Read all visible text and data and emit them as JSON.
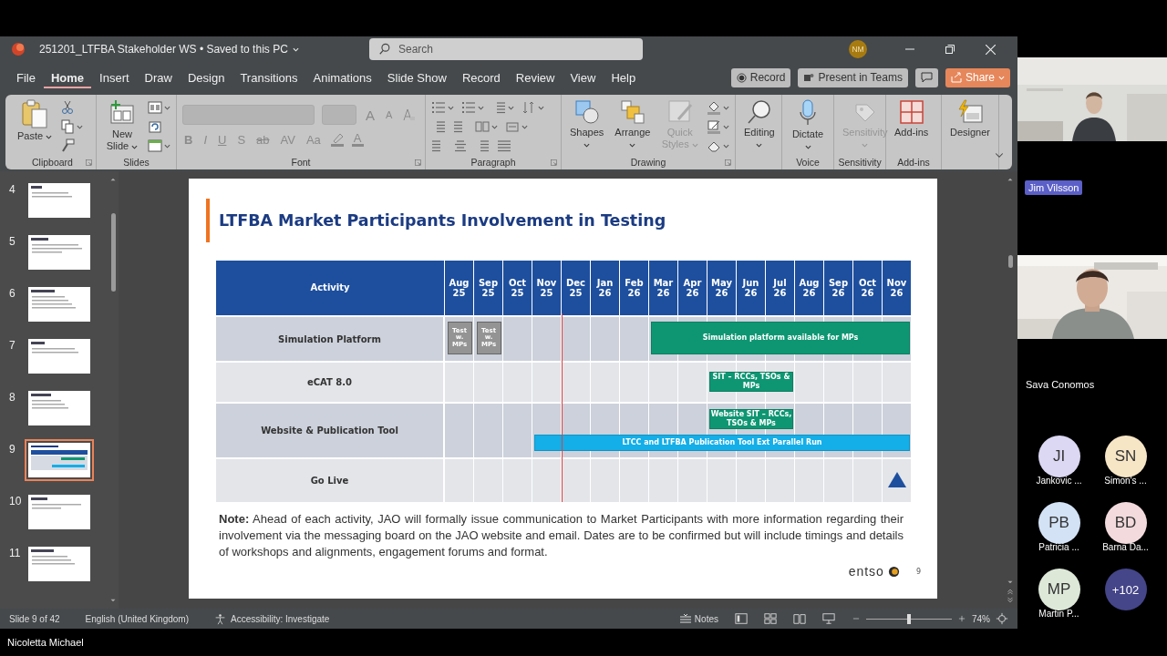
{
  "title_bar": {
    "title": "251201_LTFBA Stakeholder WS • Saved to this PC",
    "search_placeholder": "Search",
    "user_initials": "NM"
  },
  "tabs": [
    {
      "label": "File",
      "selected": false
    },
    {
      "label": "Home",
      "selected": true
    },
    {
      "label": "Insert",
      "selected": false
    },
    {
      "label": "Draw",
      "selected": false
    },
    {
      "label": "Design",
      "selected": false
    },
    {
      "label": "Transitions",
      "selected": false
    },
    {
      "label": "Animations",
      "selected": false
    },
    {
      "label": "Slide Show",
      "selected": false
    },
    {
      "label": "Record",
      "selected": false
    },
    {
      "label": "Review",
      "selected": false
    },
    {
      "label": "View",
      "selected": false
    },
    {
      "label": "Help",
      "selected": false
    }
  ],
  "actions": [
    {
      "kind": "record",
      "label": "Record"
    },
    {
      "kind": "teams",
      "label": "Present in Teams"
    },
    {
      "kind": "comments"
    },
    {
      "kind": "share",
      "label": "Share"
    }
  ],
  "ribbon": [
    {
      "kind": "clipboard",
      "label": "Clipboard",
      "buttons": [
        {
          "kind": "paste",
          "label": "Paste",
          "disabled": false,
          "has_menu": true
        }
      ]
    },
    {
      "kind": "slides",
      "label": "Slides",
      "buttons": [
        {
          "kind": "new-slide",
          "label": "New Slide",
          "disabled": false,
          "has_menu": true
        }
      ]
    },
    {
      "kind": "font",
      "label": "Font",
      "disabled": true,
      "grow": [
        "A",
        "A"
      ],
      "format": [
        "B",
        "I",
        "U",
        "S",
        "ab",
        "AV",
        "Aa"
      ],
      "color_tool": "A"
    },
    {
      "kind": "paragraph",
      "label": "Paragraph"
    },
    {
      "kind": "drawing",
      "label": "Drawing",
      "buttons": [
        {
          "kind": "shapes",
          "label": "Shapes",
          "disabled": false,
          "has_menu": true
        },
        {
          "kind": "arrange",
          "label": "Arrange",
          "disabled": false,
          "has_menu": true
        },
        {
          "kind": "quick-styles",
          "label": "Quick Styles",
          "disabled": true,
          "has_menu": true
        }
      ]
    },
    {
      "kind": "editing",
      "buttons": [
        {
          "kind": "editing",
          "label": "Editing",
          "disabled": false,
          "has_menu": true
        }
      ]
    },
    {
      "kind": "voice",
      "label": "Voice",
      "buttons": [
        {
          "kind": "dictate",
          "label": "Dictate",
          "disabled": false,
          "has_menu": true
        }
      ]
    },
    {
      "kind": "sensitivity",
      "label": "Sensitivity",
      "buttons": [
        {
          "kind": "sensitivity",
          "label": "Sensitivity",
          "disabled": true,
          "has_menu": true
        }
      ]
    },
    {
      "kind": "addins",
      "label": "Add-ins",
      "buttons": [
        {
          "kind": "addins",
          "label": "Add-ins",
          "disabled": false,
          "has_menu": false
        }
      ]
    },
    {
      "kind": "designer",
      "buttons": [
        {
          "kind": "designer",
          "label": "Designer",
          "disabled": false,
          "has_menu": false
        }
      ]
    }
  ],
  "thumbnails": [
    {
      "number": "4",
      "selected": false
    },
    {
      "number": "5",
      "selected": false
    },
    {
      "number": "6",
      "selected": false
    },
    {
      "number": "7",
      "selected": false
    },
    {
      "number": "8",
      "selected": false
    },
    {
      "number": "9",
      "selected": true
    },
    {
      "number": "10",
      "selected": false
    },
    {
      "number": "11",
      "selected": false
    }
  ],
  "slide": {
    "title": "LTFBA Market Participants Involvement in Testing",
    "table": {
      "heading": "Activity",
      "months": [
        "Aug 25",
        "Sep 25",
        "Oct 25",
        "Nov 25",
        "Dec 25",
        "Jan 26",
        "Feb 26",
        "Mar 26",
        "Apr 26",
        "May 26",
        "Jun 26",
        "Jul 26",
        "Aug 26",
        "Sep 26",
        "Oct 26",
        "Nov 26"
      ],
      "rows": [
        {
          "activity": "Simulation Platform",
          "lanes": [
            [
              {
                "kind": "test",
                "label": "Test w. MPs",
                "color": "#949494"
              },
              {
                "kind": "test",
                "label": "Test w. MPs",
                "color": "#949494"
              },
              {
                "kind": "empty"
              },
              {
                "kind": "empty"
              },
              {
                "kind": "empty"
              },
              {
                "kind": "empty"
              },
              {
                "kind": "empty"
              },
              {
                "kind": "bar",
                "label": "Simulation platform available for MPs",
                "color": "#0e9672"
              },
              {
                "kind": "cont"
              },
              {
                "kind": "cont"
              },
              {
                "kind": "cont"
              },
              {
                "kind": "cont"
              },
              {
                "kind": "cont"
              },
              {
                "kind": "cont"
              },
              {
                "kind": "cont"
              },
              {
                "kind": "cont"
              }
            ]
          ]
        },
        {
          "activity": "eCAT 8.0",
          "lanes": [
            [
              {
                "kind": "empty"
              },
              {
                "kind": "empty"
              },
              {
                "kind": "empty"
              },
              {
                "kind": "empty"
              },
              {
                "kind": "empty"
              },
              {
                "kind": "empty"
              },
              {
                "kind": "empty"
              },
              {
                "kind": "empty"
              },
              {
                "kind": "empty"
              },
              {
                "kind": "bar",
                "label": "SIT – RCCs, TSOs & MPs",
                "color": "#0e9672"
              },
              {
                "kind": "cont"
              },
              {
                "kind": "cont"
              },
              {
                "kind": "empty"
              },
              {
                "kind": "empty"
              },
              {
                "kind": "empty"
              },
              {
                "kind": "empty"
              }
            ]
          ]
        },
        {
          "activity": "Website & Publication Tool",
          "lanes": [
            [
              {
                "kind": "empty"
              },
              {
                "kind": "empty"
              },
              {
                "kind": "empty"
              },
              {
                "kind": "empty"
              },
              {
                "kind": "empty"
              },
              {
                "kind": "empty"
              },
              {
                "kind": "empty"
              },
              {
                "kind": "empty"
              },
              {
                "kind": "empty"
              },
              {
                "kind": "bar",
                "label": "Website SIT – RCCs, TSOs & MPs",
                "color": "#0e9672"
              },
              {
                "kind": "cont"
              },
              {
                "kind": "cont"
              },
              {
                "kind": "empty"
              },
              {
                "kind": "empty"
              },
              {
                "kind": "empty"
              },
              {
                "kind": "empty"
              }
            ],
            [
              {
                "kind": "empty"
              },
              {
                "kind": "empty"
              },
              {
                "kind": "empty"
              },
              {
                "kind": "bar",
                "label": "LTCC and LTFBA Publication Tool Ext Parallel Run",
                "color": "#14aee8"
              },
              {
                "kind": "cont"
              },
              {
                "kind": "cont"
              },
              {
                "kind": "cont"
              },
              {
                "kind": "cont"
              },
              {
                "kind": "cont"
              },
              {
                "kind": "cont"
              },
              {
                "kind": "cont"
              },
              {
                "kind": "cont"
              },
              {
                "kind": "cont"
              },
              {
                "kind": "cont"
              },
              {
                "kind": "cont"
              },
              {
                "kind": "cont"
              }
            ]
          ]
        },
        {
          "activity": "Go Live",
          "lanes": [
            [
              {
                "kind": "empty"
              },
              {
                "kind": "empty"
              },
              {
                "kind": "empty"
              },
              {
                "kind": "empty"
              },
              {
                "kind": "empty"
              },
              {
                "kind": "empty"
              },
              {
                "kind": "empty"
              },
              {
                "kind": "empty"
              },
              {
                "kind": "empty"
              },
              {
                "kind": "empty"
              },
              {
                "kind": "empty"
              },
              {
                "kind": "empty"
              },
              {
                "kind": "empty"
              },
              {
                "kind": "empty"
              },
              {
                "kind": "empty"
              },
              {
                "kind": "milestone",
                "color": "#1e4f9e"
              }
            ]
          ]
        }
      ]
    },
    "note": "**Note:** Ahead of each activity, JAO will formally issue communication to Market Participants with more information regarding their involvement via the messaging board on the JAO website and email. Dates are to be confirmed but will include timings and details of workshops and alignments, engagement forums and format.",
    "logo": "entso",
    "page": "9"
  },
  "status_bar": {
    "slide": "Slide 9 of 42",
    "language": "English (United Kingdom)",
    "accessibility": "Accessibility: Investigate",
    "notes": "Notes",
    "zoom": {
      "level": 0.5,
      "reading": "74%"
    }
  },
  "meeting": {
    "tiles": [
      {
        "name": "Jim Vilsson",
        "highlighted": true
      },
      {
        "name": "Sava Conomos",
        "highlighted": false
      }
    ],
    "participants": [
      {
        "initials": "JI",
        "name": "Jankovic ...",
        "color": "#dcd7f2"
      },
      {
        "initials": "SN",
        "name": "Simon's ...",
        "color": "#f7e6c6"
      },
      {
        "initials": "PB",
        "name": "Patricia ...",
        "color": "#d3e2f5"
      },
      {
        "initials": "BD",
        "name": "Barna Da...",
        "color": "#f3dadd"
      },
      {
        "initials": "MP",
        "name": "Martin P...",
        "color": "#dde8d9"
      }
    ],
    "overflow": "+102",
    "presenter": "Nicoletta Michael"
  }
}
